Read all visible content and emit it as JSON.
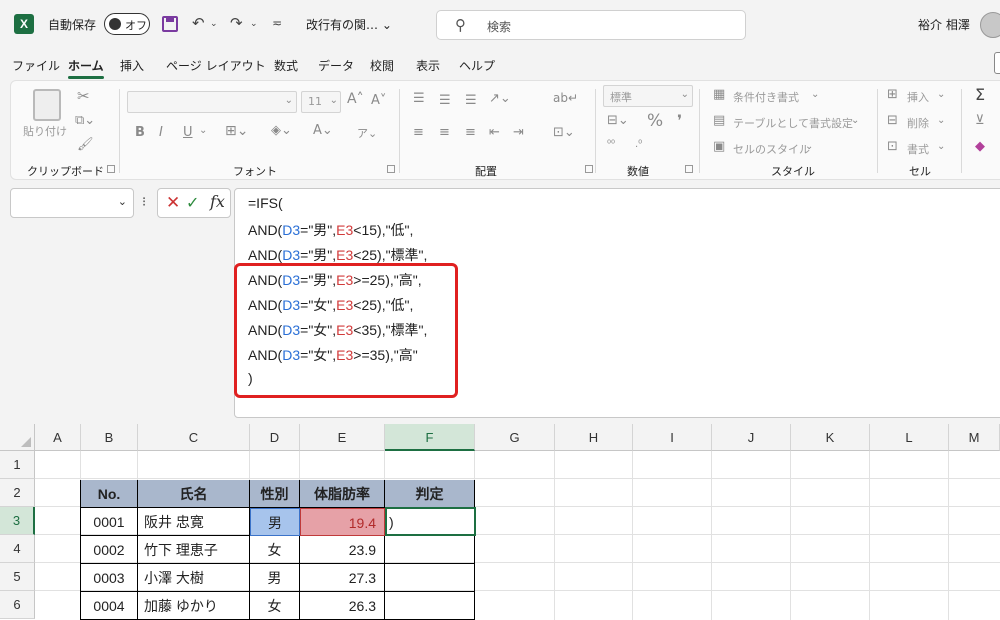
{
  "titlebar": {
    "logo": "X",
    "autosave_label": "自動保存",
    "autosave_state": "オフ",
    "doc_title": "改行有の関… ⌄",
    "search_placeholder": "検索",
    "user_name": "裕介 相澤"
  },
  "tabs": [
    "ファイル",
    "ホーム",
    "挿入",
    "ページ レイアウト",
    "数式",
    "データ",
    "校閲",
    "表示",
    "ヘルプ"
  ],
  "active_tab": "ホーム",
  "ribbon": {
    "paste": "貼り付け",
    "clipboard": "クリップボード",
    "font": "フォント",
    "font_size": "11",
    "alignment": "配置",
    "number": "数値",
    "number_format": "標準",
    "style": "スタイル",
    "cond_format": "条件付き書式",
    "table_format": "テーブルとして書式設定",
    "cell_style": "セルのスタイル",
    "cells": "セル",
    "insert": "挿入",
    "delete": "削除",
    "format": "書式"
  },
  "formula_bar": {
    "line1": "=IFS(",
    "rows": [
      {
        "p1": "AND(",
        "c1": "D3",
        "p2": "=\"男\",",
        "c2": "E3",
        "p3": "<15),\"低\","
      },
      {
        "p1": "AND(",
        "c1": "D3",
        "p2": "=\"男\",",
        "c2": "E3",
        "p3": "<25),\"標準\","
      },
      {
        "p1": "AND(",
        "c1": "D3",
        "p2": "=\"男\",",
        "c2": "E3",
        "p3": ">=25),\"高\","
      },
      {
        "p1": "AND(",
        "c1": "D3",
        "p2": "=\"女\",",
        "c2": "E3",
        "p3": "<25),\"低\","
      },
      {
        "p1": "AND(",
        "c1": "D3",
        "p2": "=\"女\",",
        "c2": "E3",
        "p3": "<35),\"標準\","
      },
      {
        "p1": "AND(",
        "c1": "D3",
        "p2": "=\"女\",",
        "c2": "E3",
        "p3": ">=35),\"高\""
      }
    ],
    "last_line": ")"
  },
  "columns": [
    "A",
    "B",
    "C",
    "D",
    "E",
    "F",
    "G",
    "H",
    "I",
    "J",
    "K",
    "L",
    "M"
  ],
  "rows": [
    "1",
    "2",
    "3",
    "4",
    "5",
    "6"
  ],
  "table": {
    "headers": [
      "No.",
      "氏名",
      "性別",
      "体脂肪率",
      "判定"
    ],
    "data": [
      [
        "0001",
        "阪井 忠寛",
        "男",
        "19.4",
        ")"
      ],
      [
        "0002",
        "竹下 理恵子",
        "女",
        "23.9",
        ""
      ],
      [
        "0003",
        "小澤 大樹",
        "男",
        "27.3",
        ""
      ],
      [
        "0004",
        "加藤 ゆかり",
        "女",
        "26.3",
        ""
      ]
    ]
  },
  "colors": {
    "accent": "#1d6f42",
    "header_fill": "#a9b7cc",
    "highlight_border": "#e02020"
  }
}
